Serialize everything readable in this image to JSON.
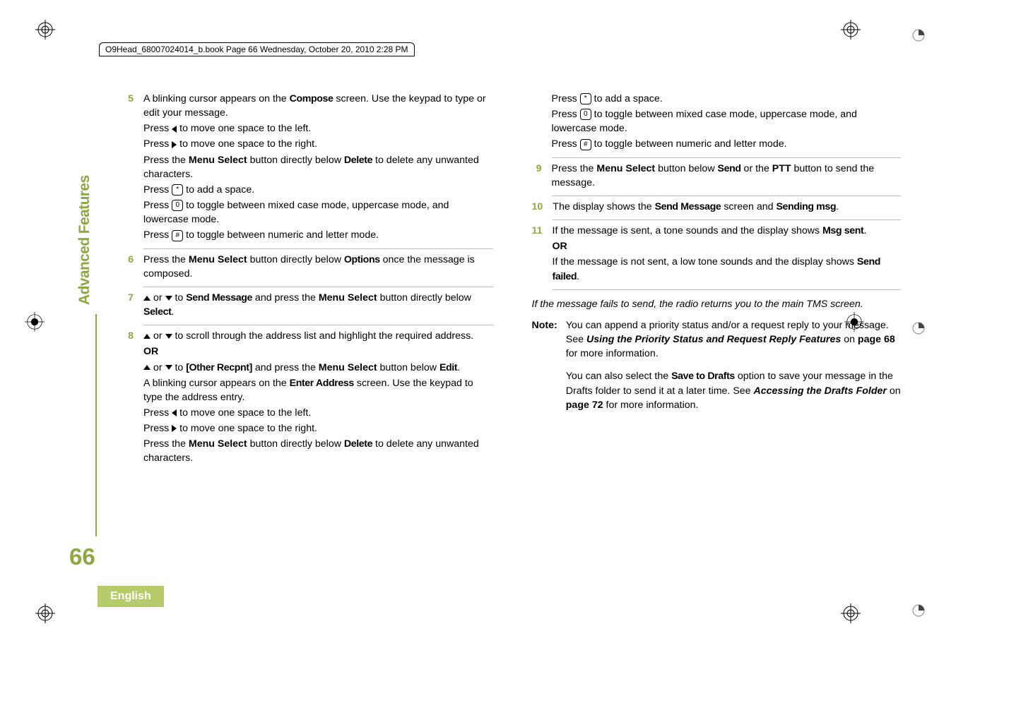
{
  "meta": {
    "running_head": "O9Head_68007024014_b.book  Page 66  Wednesday, October 20, 2010  2:28 PM",
    "side_label": "Advanced Features",
    "page_number": "66",
    "language": "English"
  },
  "glyph": {
    "star": "*",
    "zero": "0",
    "hash": "#"
  },
  "ui": {
    "menu_select": "Menu Select",
    "ptt": "PTT"
  },
  "lcd": {
    "compose": "Compose",
    "delete": "Delete",
    "options": "Options",
    "send_message": "Send Message",
    "select": "Select",
    "other_recpnt": "[Other Recpnt]",
    "edit": "Edit",
    "enter_address": "Enter Address",
    "send": "Send",
    "sending_msg": "Sending msg",
    "msg_sent": "Msg sent",
    "send_failed": "Send failed",
    "save_to_drafts": "Save to Drafts"
  },
  "text": {
    "or": " or ",
    "or_caps": "OR",
    "s5": {
      "a": "A blinking cursor appears on the ",
      "b": " screen. Use the keypad to type or edit your message.",
      "left": " to move one space to the left.",
      "right": " to move one space to the right.",
      "press_the": "Press the ",
      "below": " button directly below ",
      "del2": " to delete any unwanted characters.",
      "space": " to add a space.",
      "mixed": " to toggle between mixed case mode, uppercase mode, and lowercase mode.",
      "numletter": " to toggle between numeric and letter mode.",
      "press": "Press "
    },
    "s6": {
      "a": "Press the ",
      "b": " button directly below ",
      "c": " once the message is composed."
    },
    "s7": {
      "a": " to ",
      "b": " and press the ",
      "c": " button directly below ",
      "d": "."
    },
    "s8": {
      "a": " to scroll through the address list and highlight the required address.",
      "b": " to ",
      "c": " and press the ",
      "d": " button below ",
      "e": ".",
      "f": "A blinking cursor appears on the ",
      "g": " screen. Use the keypad to type the address entry.",
      "left": " to move one space to the left.",
      "right": " to move one space to the right.",
      "press_the": "Press the ",
      "below": " button directly below ",
      "del2": " to delete any unwanted characters."
    },
    "r_top": {
      "space": " to add a space.",
      "mixed": " to toggle between mixed case mode, uppercase mode, and lowercase mode.",
      "numletter": " to toggle between numeric and letter mode.",
      "press": "Press "
    },
    "s9": {
      "a": "Press the ",
      "b": " button below ",
      "c": " or the ",
      "d": " button to send the message."
    },
    "s10": {
      "a": "The display shows the ",
      "b": " screen and ",
      "c": "."
    },
    "s11": {
      "a": "If the message is sent, a tone sounds and the display shows ",
      "b": ".",
      "c": "If the message is not sent, a low tone sounds and the display shows ",
      "d": "."
    },
    "tail": "If the message fails to send, the radio returns you to the main TMS screen.",
    "note_label": "Note:",
    "note1a": "You can append a priority status and/or a request reply to your message. See ",
    "note1b": "Using the Priority Status and Request Reply Features",
    "note1c": " on ",
    "note1d": "page 68",
    "note1e": " for more information.",
    "note2a": "You can also select the ",
    "note2b": " option to save your message in the Drafts folder to send it at a later time. See ",
    "note2c": "Accessing the Drafts Folder",
    "note2d": " on ",
    "note2e": "page 72",
    "note2f": " for more information."
  },
  "stepnums": {
    "s5": "5",
    "s6": "6",
    "s7": "7",
    "s8": "8",
    "s9": "9",
    "s10": "10",
    "s11": "11"
  }
}
